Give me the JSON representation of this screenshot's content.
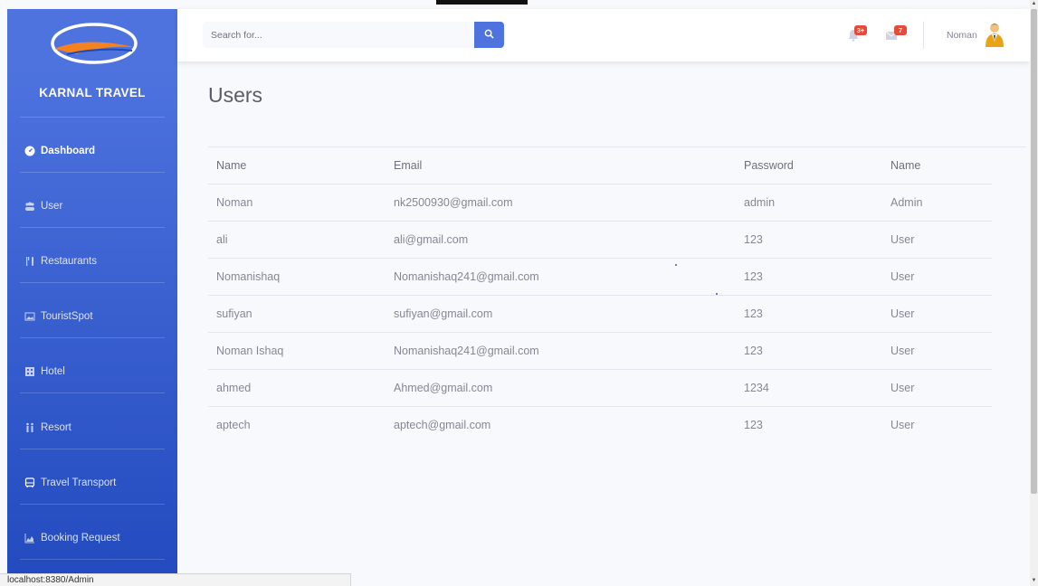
{
  "brand": {
    "name": "KARNAL TRAVEL"
  },
  "sidebar": {
    "items": [
      {
        "label": "Dashboard",
        "icon": "tachometer-icon",
        "active": true
      },
      {
        "label": "User",
        "icon": "users-icon"
      },
      {
        "label": "Restaurants",
        "icon": "utensils-icon"
      },
      {
        "label": "TouristSpot",
        "icon": "image-icon"
      },
      {
        "label": "Hotel",
        "icon": "building-icon"
      },
      {
        "label": "Resort",
        "icon": "people-icon"
      },
      {
        "label": "Travel Transport",
        "icon": "bus-icon"
      },
      {
        "label": "Booking Request",
        "icon": "chart-area-icon"
      }
    ]
  },
  "topbar": {
    "search_placeholder": "Search for...",
    "alerts_badge": "3+",
    "messages_badge": "7",
    "user_name": "Noman"
  },
  "page": {
    "title": "Users"
  },
  "table": {
    "headers": [
      "Name",
      "Email",
      "Password",
      "Name"
    ],
    "rows": [
      [
        "Noman",
        "nk2500930@gmail.com",
        "admin",
        "Admin"
      ],
      [
        "ali",
        "ali@gmail.com",
        "123",
        "User"
      ],
      [
        "Nomanishaq",
        "Nomanishaq241@gmail.com",
        "123",
        "User"
      ],
      [
        "sufiyan",
        "sufiyan@gmail.com",
        "123",
        "User"
      ],
      [
        "Noman Ishaq",
        "Nomanishaq241@gmail.com",
        "123",
        "User"
      ],
      [
        "ahmed",
        "Ahmed@gmail.com",
        "1234",
        "User"
      ],
      [
        "aptech",
        "aptech@gmail.com",
        "123",
        "User"
      ]
    ]
  },
  "status_bar": {
    "url": "localhost:8380/Admin"
  },
  "colors": {
    "primary": "#4e73df",
    "sidebar_bottom": "#224abe",
    "badge": "#e74a3b"
  }
}
